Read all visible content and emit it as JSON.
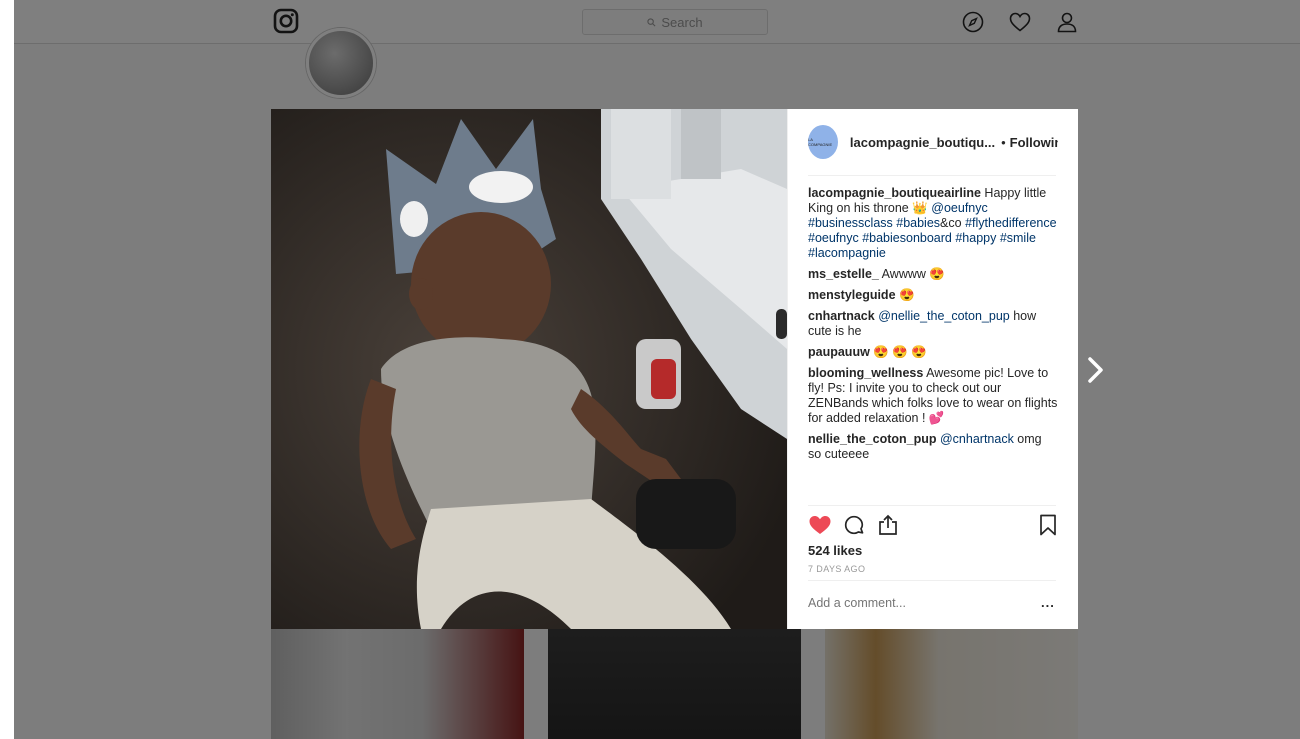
{
  "nav": {
    "search_placeholder": "Search",
    "icons": [
      "instagram-logo-icon",
      "search-icon",
      "compass-icon",
      "heart-icon",
      "person-icon"
    ]
  },
  "post": {
    "username": "lacompagnie_boutiqu...",
    "separator": "•",
    "following": "Following",
    "avatar_text": "LA COMPAGNIE",
    "caption": {
      "user": "lacompagnie_boutiqueairline",
      "text1": " Happy little King on his throne 👑  ",
      "mention": "@oeufnyc",
      "tags1": "#businessclass #babies",
      "text2": "&co",
      "tags2": "#flythedifference #oeufnyc #babiesonboard #happy #smile #lacompagnie"
    },
    "comments": [
      {
        "user": "ms_estelle_",
        "text": " Awwww 😍"
      },
      {
        "user": "menstyleguide",
        "text": " 😍"
      },
      {
        "user": "cnhartnack",
        "mention": "@nellie_the_coton_pup",
        "text": " how cute is he"
      },
      {
        "user": "paupauuw",
        "text": " 😍 😍 😍"
      },
      {
        "user": "blooming_wellness",
        "text": " Awesome pic! Love to fly! Ps: I invite you to check out our ZENBands which folks love to wear on flights for added relaxation ! 💕"
      },
      {
        "user": "nellie_the_coton_pup",
        "mention": "@cnhartnack",
        "text": " omg so cuteeee"
      }
    ],
    "likes": "524 likes",
    "time_ago": "7 DAYS AGO",
    "add_comment_placeholder": "Add a comment...",
    "more": "...",
    "like_color": "#ed4956",
    "tag_color": "#003569"
  }
}
